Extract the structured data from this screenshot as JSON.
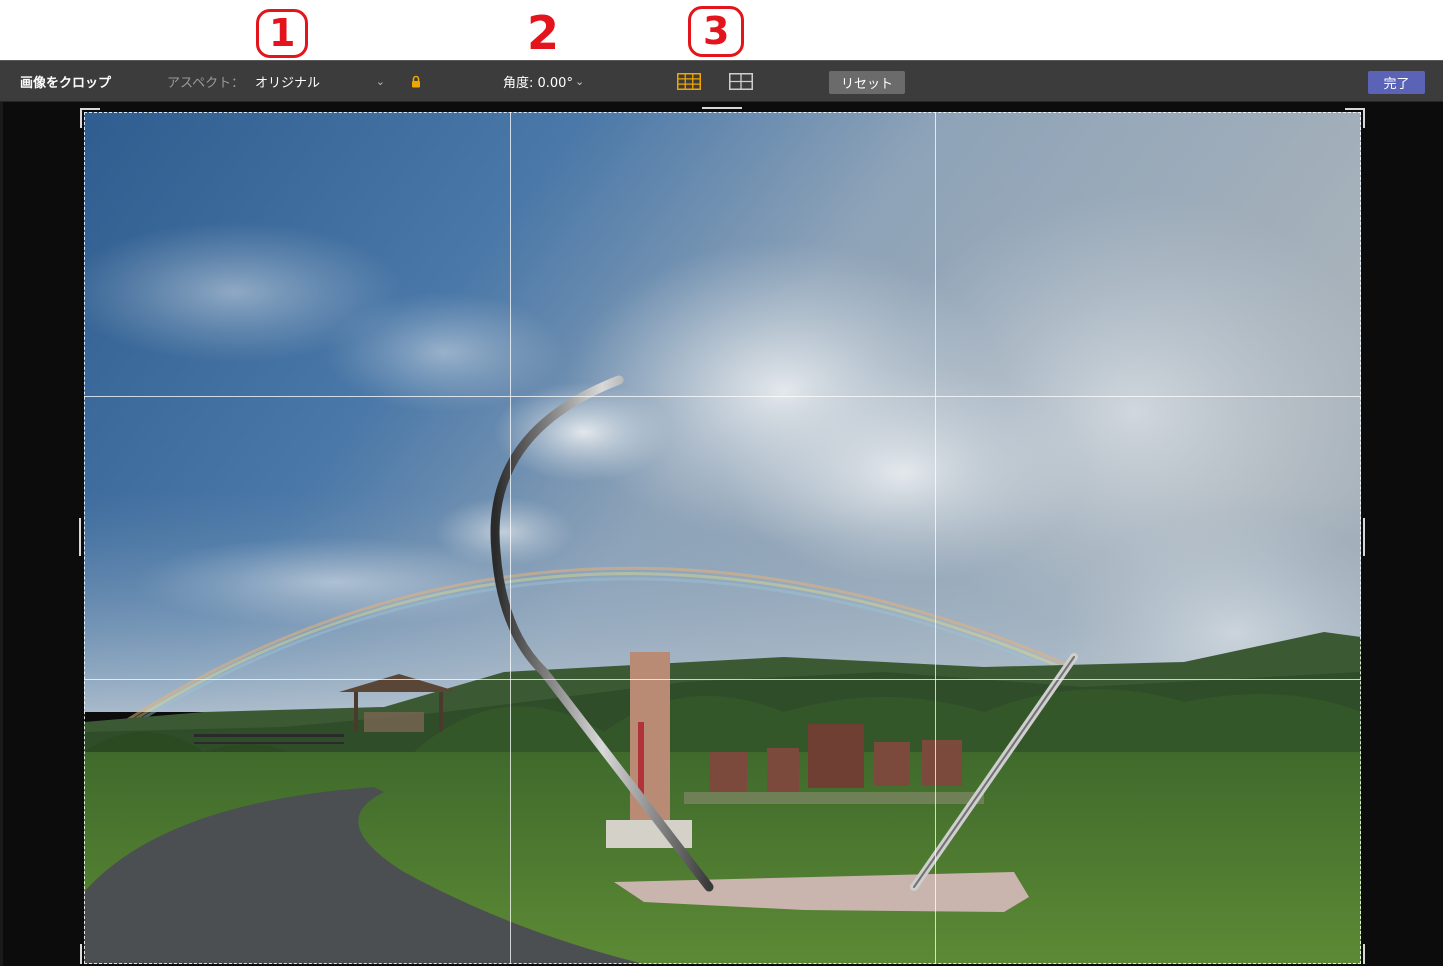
{
  "annotations": [
    "1",
    "2",
    "3"
  ],
  "toolbar": {
    "title": "画像をクロップ",
    "aspect_label": "アスペクト：",
    "aspect_value": "オリジナル",
    "angle_label": "角度: 0.00°",
    "reset_label": "リセット",
    "done_label": "完了"
  },
  "icons": {
    "aspect_dropdown": "chevron-down-icon",
    "aspect_lock": "lock-icon",
    "angle_dropdown": "chevron-down-icon",
    "grid_thirds": "grid-3x3-icon",
    "grid_halves": "grid-2x2-icon"
  },
  "colors": {
    "toolbar_bg": "#3c3c3c",
    "workspace_bg": "#0c0c0c",
    "lock_and_active_grid": "#f0a500",
    "done_button": "#5b63b7",
    "reset_button": "#6b6b6b",
    "annotation": "#e3141b"
  },
  "state": {
    "active_grid": "thirds",
    "aspect_locked": true
  }
}
